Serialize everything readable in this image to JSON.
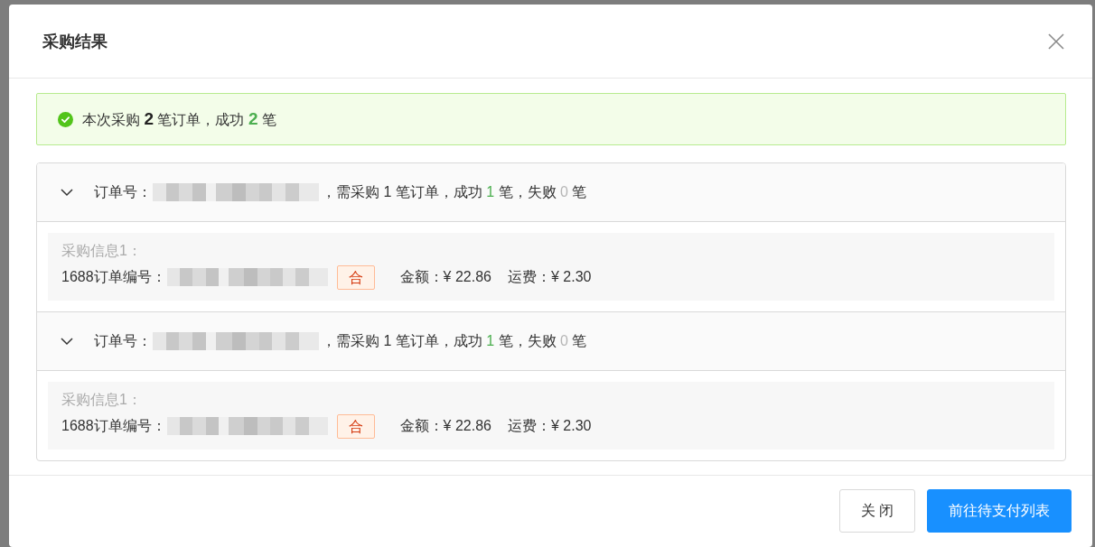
{
  "dialog": {
    "title": "采购结果"
  },
  "alert": {
    "kind": "success",
    "parts": [
      {
        "text": "本次采购 ",
        "kind": "text"
      },
      {
        "text": "2",
        "kind": "count"
      },
      {
        "text": " 笔订单，成功 ",
        "kind": "text"
      },
      {
        "text": "2",
        "kind": "count_success"
      },
      {
        "text": " 笔",
        "kind": "text"
      }
    ]
  },
  "orders": [
    {
      "expanded": true,
      "order_label": "订单号：",
      "summary": [
        {
          "text": "，需采购 1 笔订单，成功 ",
          "kind": "text"
        },
        {
          "text": "1",
          "kind": "success"
        },
        {
          "text": " 笔，失败 ",
          "kind": "text"
        },
        {
          "text": "0",
          "kind": "fail"
        },
        {
          "text": " 笔",
          "kind": "text"
        }
      ],
      "purchases": [
        {
          "title": "采购信息1：",
          "order_no_label": "1688订单编号：",
          "tag": "合",
          "amount": "金额：¥ 22.86",
          "freight": "运费：¥ 2.30"
        }
      ]
    },
    {
      "expanded": true,
      "order_label": "订单号：",
      "summary": [
        {
          "text": "，需采购 1 笔订单，成功 ",
          "kind": "text"
        },
        {
          "text": "1",
          "kind": "success"
        },
        {
          "text": " 笔，失败 ",
          "kind": "text"
        },
        {
          "text": "0",
          "kind": "fail"
        },
        {
          "text": " 笔",
          "kind": "text"
        }
      ],
      "purchases": [
        {
          "title": "采购信息1：",
          "order_no_label": "1688订单编号：",
          "tag": "合",
          "amount": "金额：¥ 22.86",
          "freight": "运费：¥ 2.30"
        }
      ]
    }
  ],
  "buttons": [
    {
      "label": "关 闭",
      "kind": "default"
    },
    {
      "label": "前往待支付列表",
      "kind": "primary"
    }
  ]
}
